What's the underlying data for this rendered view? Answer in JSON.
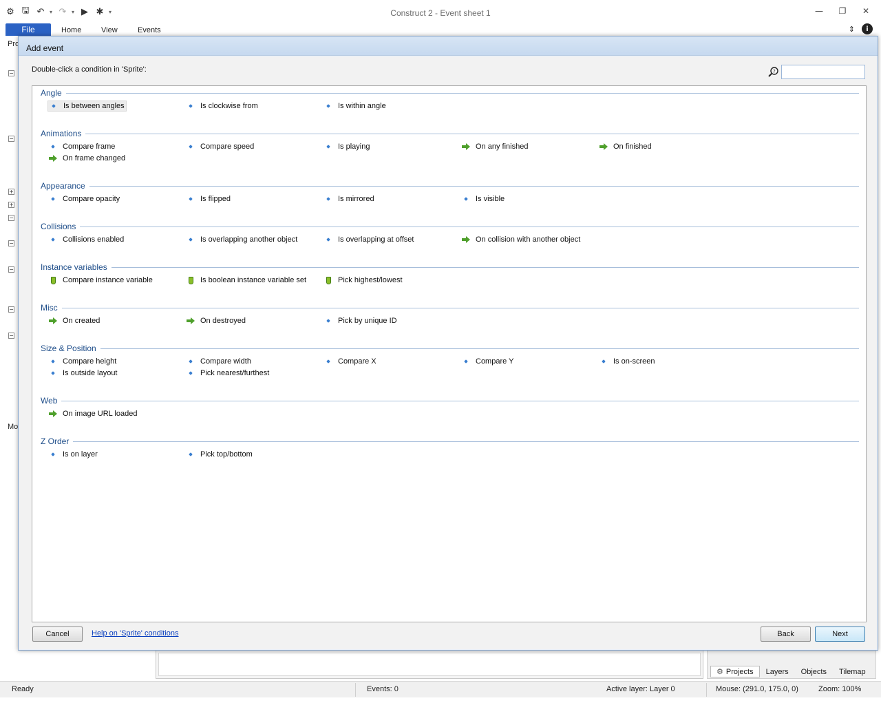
{
  "window": {
    "title": "Construct 2 - Event sheet 1",
    "ribbon_tabs": {
      "file": "File",
      "home": "Home",
      "view": "View",
      "events": "Events"
    },
    "left_strip": {
      "top_label": "Pro",
      "bottom_label": "Mo"
    }
  },
  "dialog": {
    "title": "Add event",
    "prompt": "Double-click a condition in 'Sprite':",
    "search": {
      "value": "",
      "placeholder": ""
    },
    "categories": [
      {
        "name": "Angle",
        "items": [
          {
            "label": "Is between angles",
            "icon": "condition",
            "selected": true
          },
          {
            "label": "Is clockwise from",
            "icon": "condition"
          },
          {
            "label": "Is within angle",
            "icon": "condition"
          }
        ]
      },
      {
        "name": "Animations",
        "items": [
          {
            "label": "Compare frame",
            "icon": "condition"
          },
          {
            "label": "Compare speed",
            "icon": "condition"
          },
          {
            "label": "Is playing",
            "icon": "condition"
          },
          {
            "label": "On any finished",
            "icon": "trigger"
          },
          {
            "label": "On finished",
            "icon": "trigger"
          },
          {
            "label": "On frame changed",
            "icon": "trigger"
          }
        ]
      },
      {
        "name": "Appearance",
        "items": [
          {
            "label": "Compare opacity",
            "icon": "condition"
          },
          {
            "label": "Is flipped",
            "icon": "condition"
          },
          {
            "label": "Is mirrored",
            "icon": "condition"
          },
          {
            "label": "Is visible",
            "icon": "condition"
          }
        ]
      },
      {
        "name": "Collisions",
        "items": [
          {
            "label": "Collisions enabled",
            "icon": "condition"
          },
          {
            "label": "Is overlapping another object",
            "icon": "condition"
          },
          {
            "label": "Is overlapping at offset",
            "icon": "condition"
          },
          {
            "label": "On collision with another object",
            "icon": "trigger"
          }
        ]
      },
      {
        "name": "Instance variables",
        "items": [
          {
            "label": "Compare instance variable",
            "icon": "variable"
          },
          {
            "label": "Is boolean instance variable set",
            "icon": "variable"
          },
          {
            "label": "Pick highest/lowest",
            "icon": "variable"
          }
        ]
      },
      {
        "name": "Misc",
        "items": [
          {
            "label": "On created",
            "icon": "trigger"
          },
          {
            "label": "On destroyed",
            "icon": "trigger"
          },
          {
            "label": "Pick by unique ID",
            "icon": "condition"
          }
        ]
      },
      {
        "name": "Size & Position",
        "items": [
          {
            "label": "Compare height",
            "icon": "condition"
          },
          {
            "label": "Compare width",
            "icon": "condition"
          },
          {
            "label": "Compare X",
            "icon": "condition"
          },
          {
            "label": "Compare Y",
            "icon": "condition"
          },
          {
            "label": "Is on-screen",
            "icon": "condition"
          },
          {
            "label": "Is outside layout",
            "icon": "condition"
          },
          {
            "label": "Pick nearest/furthest",
            "icon": "condition"
          }
        ]
      },
      {
        "name": "Web",
        "items": [
          {
            "label": "On image URL loaded",
            "icon": "trigger"
          }
        ]
      },
      {
        "name": "Z Order",
        "items": [
          {
            "label": "Is on layer",
            "icon": "condition"
          },
          {
            "label": "Pick top/bottom",
            "icon": "condition"
          }
        ]
      }
    ],
    "buttons": {
      "cancel": "Cancel",
      "help": "Help on 'Sprite' conditions",
      "back": "Back",
      "next": "Next"
    }
  },
  "panel_tabs": [
    "Projects",
    "Layers",
    "Objects",
    "Tilemap"
  ],
  "statusbar": {
    "ready": "Ready",
    "events": "Events: 0",
    "active_layer": "Active layer: Layer 0",
    "mouse": "Mouse: (291.0, 175.0, 0)",
    "zoom": "Zoom: 100%"
  },
  "colors": {
    "accent": "#2b62c4",
    "category_text": "#1f4e8a",
    "trigger_green": "#4fa02c",
    "condition_blue": "#3a7fd0"
  }
}
